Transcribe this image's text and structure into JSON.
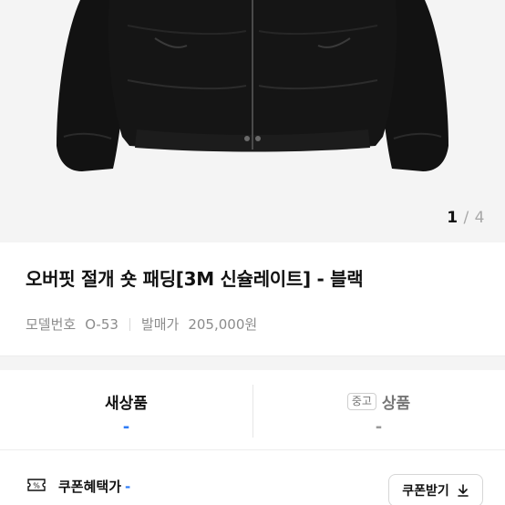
{
  "gallery": {
    "current": "1",
    "separator": "/",
    "total": "4"
  },
  "product": {
    "title": "오버핏 절개 숏 패딩[3M 신슐레이트] - 블랙",
    "model_label": "모델번호",
    "model_value": "O-53",
    "price_label": "발매가",
    "price_value": "205,000원"
  },
  "tabs": [
    {
      "label": "새상품",
      "value": "-",
      "active": true
    },
    {
      "tag": "중고",
      "label": "상품",
      "value": "-",
      "active": false
    }
  ],
  "coupon": {
    "label": "쿠폰혜택가",
    "value": "-",
    "button_label": "쿠폰받기"
  },
  "colors": {
    "accent": "#2f7cf6",
    "jacket": "#121212"
  }
}
